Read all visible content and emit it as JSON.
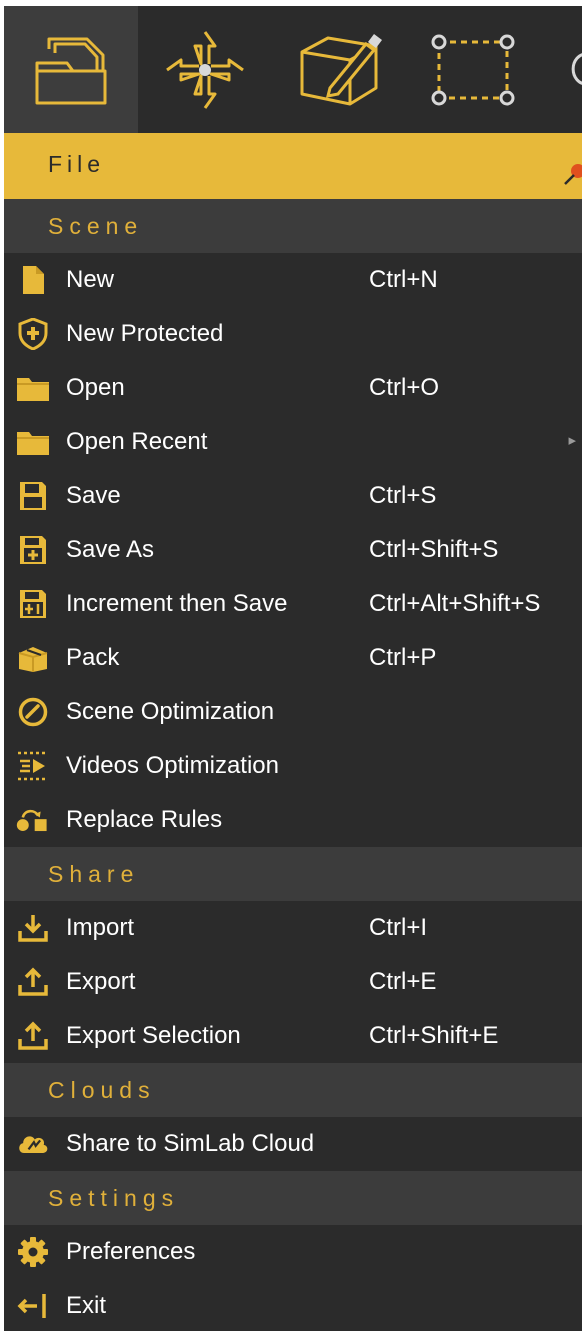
{
  "toolbar": {
    "tools": [
      {
        "name": "file-folder-icon",
        "active": true
      },
      {
        "name": "move-arrows-icon",
        "active": false
      },
      {
        "name": "edit-box-icon",
        "active": false
      },
      {
        "name": "select-rectangle-icon",
        "active": false
      }
    ]
  },
  "title": {
    "label": "File",
    "pin_icon": "pin-icon"
  },
  "accent": "#e7b93a",
  "menu": {
    "scene": {
      "header": "Scene",
      "items": [
        {
          "label": "New",
          "shortcut": "Ctrl+N",
          "icon": "document-icon"
        },
        {
          "label": "New Protected",
          "shortcut": "",
          "icon": "shield-icon"
        },
        {
          "label": "Open",
          "shortcut": "Ctrl+O",
          "icon": "folder-icon"
        },
        {
          "label": "Open Recent",
          "shortcut": "",
          "icon": "folder-icon",
          "submenu": "▸"
        },
        {
          "label": "Save",
          "shortcut": "Ctrl+S",
          "icon": "floppy-icon"
        },
        {
          "label": "Save As",
          "shortcut": "Ctrl+Shift+S",
          "icon": "floppy-plus-icon"
        },
        {
          "label": "Increment then Save",
          "shortcut": "Ctrl+Alt+Shift+S",
          "icon": "floppy-increment-icon"
        },
        {
          "label": "Pack",
          "shortcut": "Ctrl+P",
          "icon": "package-icon"
        },
        {
          "label": "Scene Optimization",
          "shortcut": "",
          "icon": "gauge-icon"
        },
        {
          "label": "Videos Optimization",
          "shortcut": "",
          "icon": "video-optimize-icon"
        },
        {
          "label": "Replace Rules",
          "shortcut": "",
          "icon": "replace-shapes-icon"
        }
      ]
    },
    "share": {
      "header": "Share",
      "items": [
        {
          "label": "Import",
          "shortcut": "Ctrl+I",
          "icon": "import-icon"
        },
        {
          "label": "Export",
          "shortcut": "Ctrl+E",
          "icon": "export-icon"
        },
        {
          "label": "Export Selection",
          "shortcut": "Ctrl+Shift+E",
          "icon": "export-icon"
        }
      ]
    },
    "clouds": {
      "header": "Clouds",
      "items": [
        {
          "label": "Share to SimLab Cloud",
          "shortcut": "",
          "icon": "cloud-share-icon"
        }
      ]
    },
    "settings": {
      "header": "Settings",
      "items": [
        {
          "label": "Preferences",
          "shortcut": "",
          "icon": "gear-icon"
        },
        {
          "label": "Exit",
          "shortcut": "",
          "icon": "exit-icon"
        }
      ]
    }
  }
}
